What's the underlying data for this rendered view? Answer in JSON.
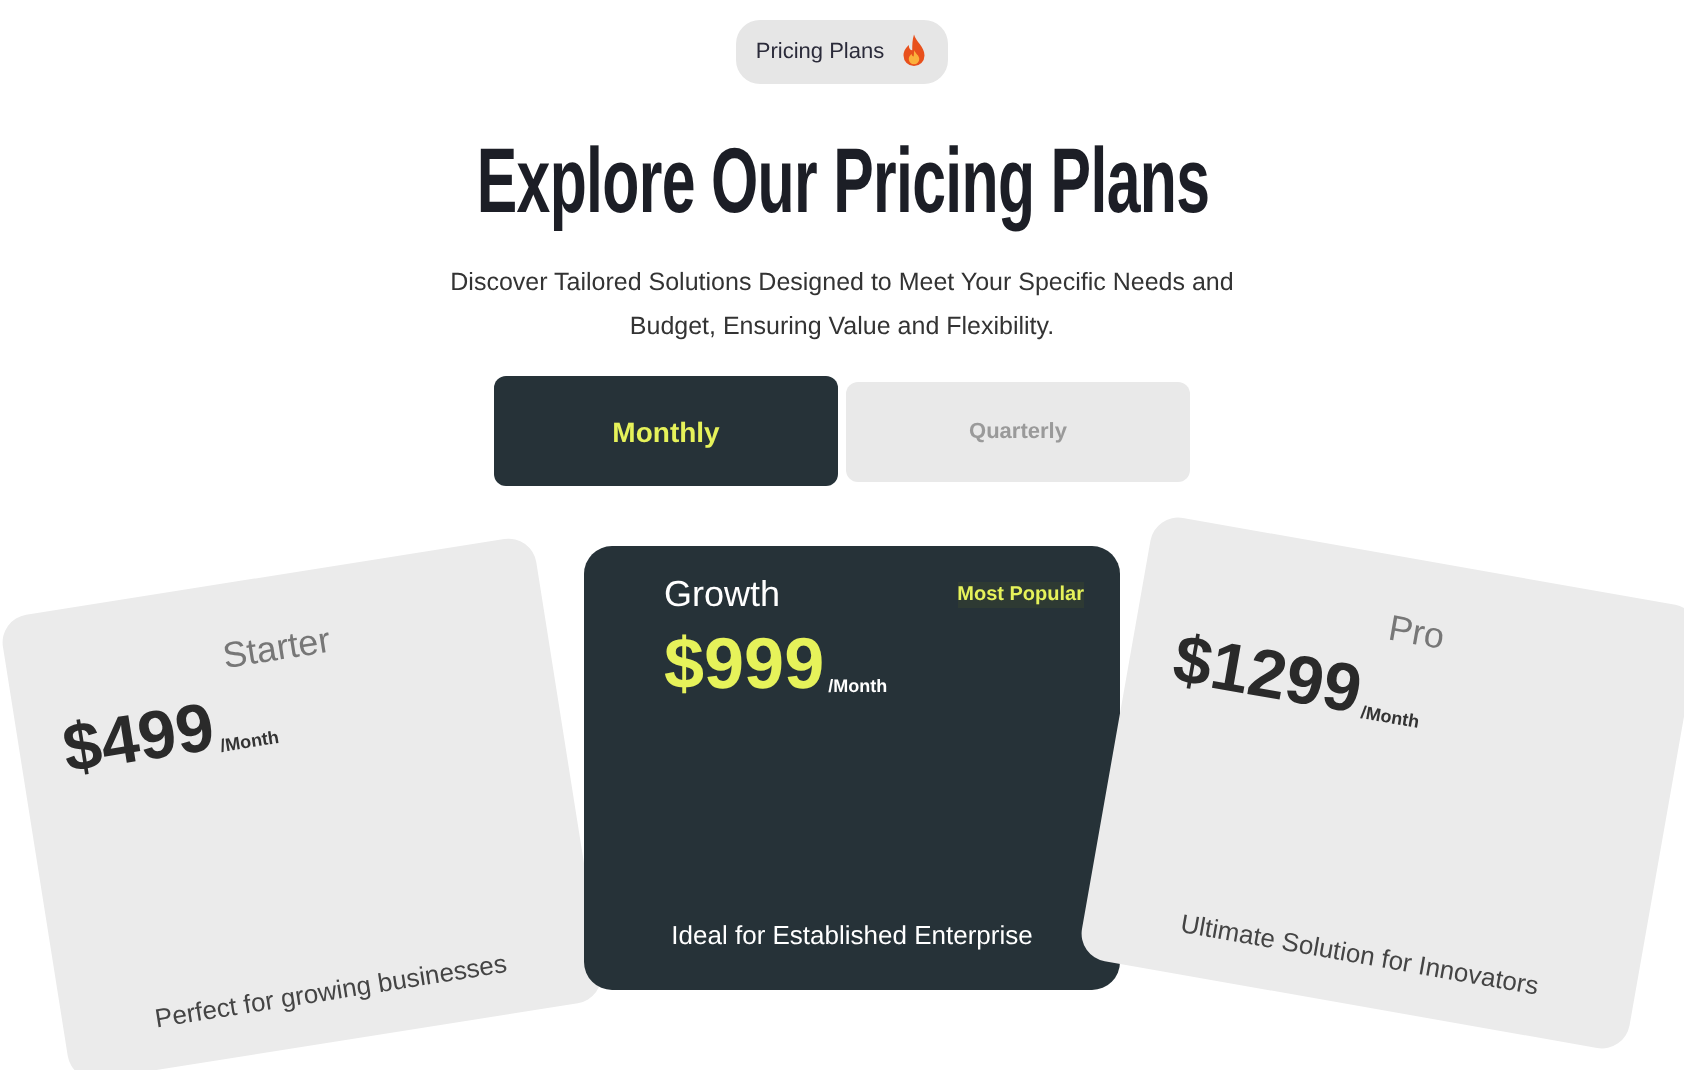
{
  "badge": {
    "label": "Pricing Plans"
  },
  "title": "Explore Our Pricing Plans",
  "subtitle": "Discover Tailored Solutions Designed to Meet Your Specific Needs and Budget, Ensuring Value and Flexibility.",
  "billing_tabs": [
    {
      "label": "Monthly",
      "selected": true
    },
    {
      "label": "Quarterly",
      "selected": false
    }
  ],
  "plans": [
    {
      "name": "Starter",
      "price": "$499",
      "period": "/Month",
      "description": "Perfect for growing businesses",
      "featured": false
    },
    {
      "name": "Growth",
      "badge": "Most Popular",
      "price": "$999",
      "period": "/Month",
      "description": "Ideal for Established Enterprise",
      "featured": true
    },
    {
      "name": "Pro",
      "price": "$1299",
      "period": "/Month",
      "description": "Ultimate Solution for Innovators",
      "featured": false
    }
  ]
}
